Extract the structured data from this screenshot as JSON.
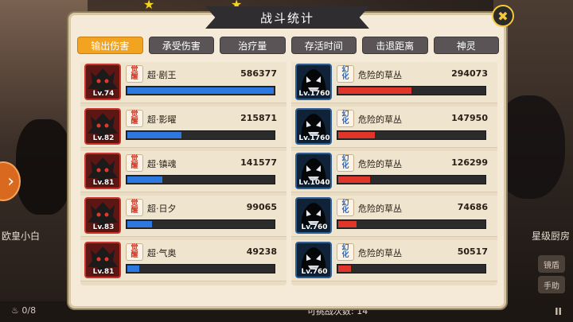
{
  "panel": {
    "title": "战斗统计",
    "close_label": "✖"
  },
  "tabs": [
    {
      "label": "输出伤害",
      "active": true
    },
    {
      "label": "承受伤害",
      "active": false
    },
    {
      "label": "治疗量",
      "active": false
    },
    {
      "label": "存活时间",
      "active": false
    },
    {
      "label": "击退距离",
      "active": false
    },
    {
      "label": "神灵",
      "active": false
    }
  ],
  "allies": [
    {
      "badge_top": "觉",
      "badge_bottom": "醒",
      "name": "超·剧王",
      "level": "Lv.74",
      "value": "586377",
      "share": 1.0
    },
    {
      "badge_top": "觉",
      "badge_bottom": "醒",
      "name": "超·影曜",
      "level": "Lv.82",
      "value": "215871",
      "share": 0.368
    },
    {
      "badge_top": "觉",
      "badge_bottom": "醒",
      "name": "超·镇魂",
      "level": "Lv.81",
      "value": "141577",
      "share": 0.241
    },
    {
      "badge_top": "觉",
      "badge_bottom": "醒",
      "name": "超·日夕",
      "level": "Lv.83",
      "value": "99065",
      "share": 0.169
    },
    {
      "badge_top": "觉",
      "badge_bottom": "醒",
      "name": "超·气奥",
      "level": "Lv.81",
      "value": "49238",
      "share": 0.084
    }
  ],
  "enemies": [
    {
      "badge_top": "幻",
      "badge_bottom": "化",
      "name": "危险的草丛",
      "level": "Lv.1760",
      "value": "294073",
      "share": 0.502
    },
    {
      "badge_top": "幻",
      "badge_bottom": "化",
      "name": "危险的草丛",
      "level": "Lv.1760",
      "value": "147950",
      "share": 0.252
    },
    {
      "badge_top": "幻",
      "badge_bottom": "化",
      "name": "危险的草丛",
      "level": "Lv.1040",
      "value": "126299",
      "share": 0.215
    },
    {
      "badge_top": "幻",
      "badge_bottom": "化",
      "name": "危险的草丛",
      "level": "Lv.760",
      "value": "74686",
      "share": 0.127
    },
    {
      "badge_top": "幻",
      "badge_bottom": "化",
      "name": "危险的草丛",
      "level": "Lv.760",
      "value": "50517",
      "share": 0.086
    }
  ],
  "background": {
    "left_label": "欧皇小白",
    "right_label": "星级厨房",
    "counter": "0/8",
    "bottom_text": "可挑战次数: 14",
    "right_buttons": [
      "镜盾",
      "手助"
    ],
    "pause_label": "II"
  },
  "colors": {
    "ally_bar": "#2d78e0",
    "enemy_bar": "#e2352a",
    "active_tab": "#f2a420"
  }
}
